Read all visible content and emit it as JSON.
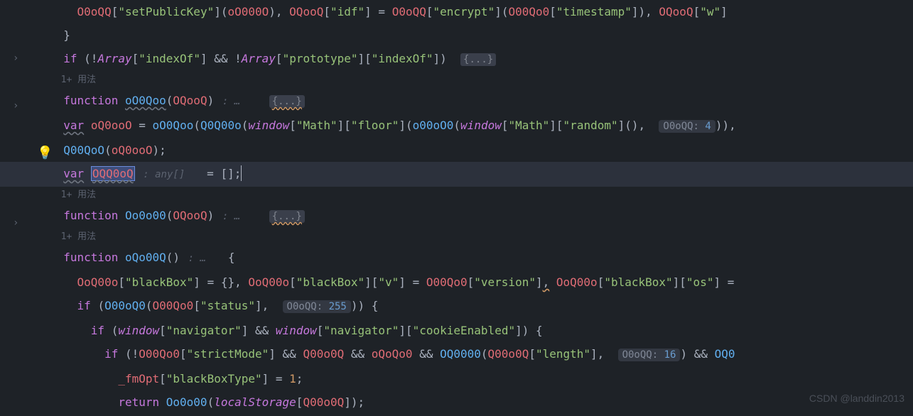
{
  "code": {
    "l1": {
      "ident": "O0oQQ",
      "s1": "\"setPublicKey\"",
      "arg1": "oO000O",
      "id2": "OQooQ",
      "s2": "\"idf\"",
      "id3": "O0oQQ",
      "s3": "\"encrypt\"",
      "id4": "O00Qo0",
      "s4": "\"timestamp\"",
      "id5": "OQooQ",
      "s5": "\"w\""
    },
    "l3": {
      "if": "if",
      "arr1": "Array",
      "s1": "\"indexOf\"",
      "arr2": "Array",
      "s2": "\"prototype\"",
      "s3": "\"indexOf\"",
      "fold": "{...}"
    },
    "lens1": "1+ 用法",
    "l5": {
      "fn": "function",
      "name": "oO0Qoo",
      "param": "OQooQ",
      "hint": ": …",
      "fold": "{...}"
    },
    "l6": {
      "var": "var",
      "v1": "oQ0ooO",
      "fn1": "oO0Qoo",
      "fn2": "Q0Q00o",
      "win1": "window",
      "s1": "\"Math\"",
      "s2": "\"floor\"",
      "fn3": "o00oO0",
      "win2": "window",
      "s3": "\"Math\"",
      "s4": "\"random\"",
      "inlayLabel": "O0oQQ:",
      "inlayVal": "4"
    },
    "l7": {
      "fn": "Q00QoO",
      "arg": "oQ0ooO"
    },
    "l8": {
      "var": "var",
      "name": "OQQ0oQ",
      "type": ": any[]",
      "val": "[]"
    },
    "lens2": "1+ 用法",
    "l10": {
      "fn": "function",
      "name": "Oo0o00",
      "param": "OQooQ",
      "hint": ": …",
      "fold": "{...}"
    },
    "lens3": "1+ 用法",
    "l12": {
      "fn": "function",
      "name": "oQo00Q",
      "hint": ": …"
    },
    "l13": {
      "id1": "OoQ00o",
      "s1": "\"blackBox\"",
      "id2": "OoQ00o",
      "s2": "\"blackBox\"",
      "s3": "\"v\"",
      "id3": "O00Qo0",
      "s4": "\"version\"",
      "id4": "OoQ00o",
      "s5": "\"blackBox\"",
      "s6": "\"os\""
    },
    "l14": {
      "if": "if",
      "fn": "O00oQ0",
      "id": "O00Qo0",
      "s1": "\"status\"",
      "inlayLabel": "O0oQQ:",
      "inlayVal": "255"
    },
    "l15": {
      "if": "if",
      "win1": "window",
      "s1": "\"navigator\"",
      "win2": "window",
      "s2": "\"navigator\"",
      "s3": "\"cookieEnabled\""
    },
    "l16": {
      "if": "if",
      "id1": "O00Qo0",
      "s1": "\"strictMode\"",
      "id2": "Q00o0Q",
      "id3": "oQoQo0",
      "fn": "OQ0000",
      "id4": "Q00o0Q",
      "s2": "\"length\"",
      "inlayLabel": "O0oQQ:",
      "inlayVal": "16",
      "id5": "OQ0"
    },
    "l17": {
      "id": "_fmOpt",
      "s": "\"blackBoxType\"",
      "v": "1"
    },
    "l18": {
      "ret": "return",
      "fn": "Oo0o00",
      "ls": "localStorage",
      "id": "Q00o0Q"
    }
  },
  "watermark": "CSDN @landdin2013",
  "foldArrows": {
    "a1": "›",
    "a2": "›",
    "a3": "›"
  },
  "bulb": "💡"
}
